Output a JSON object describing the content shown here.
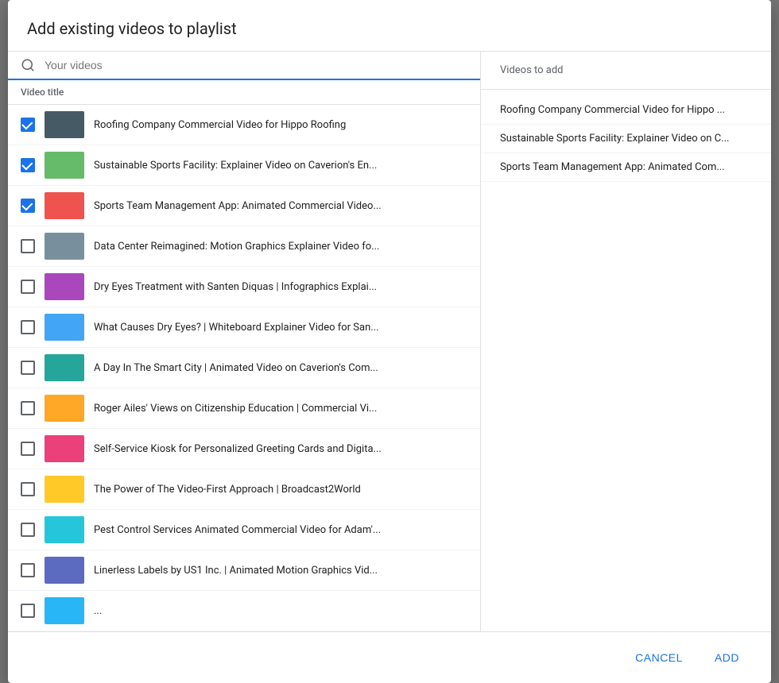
{
  "dialog": {
    "title": "Add existing videos to playlist"
  },
  "search": {
    "placeholder": "Your videos"
  },
  "column_header": "Video title",
  "videos": [
    {
      "id": 1,
      "title": "Roofing Company Commercial Video for Hippo Roofing",
      "checked": true,
      "thumb_class": "thumb-1"
    },
    {
      "id": 2,
      "title": "Sustainable Sports Facility: Explainer Video on Caverion's En...",
      "checked": true,
      "thumb_class": "thumb-2"
    },
    {
      "id": 3,
      "title": "Sports Team Management App: Animated Commercial Video...",
      "checked": true,
      "thumb_class": "thumb-3"
    },
    {
      "id": 4,
      "title": "Data Center Reimagined: Motion Graphics Explainer Video fo...",
      "checked": false,
      "thumb_class": "thumb-4"
    },
    {
      "id": 5,
      "title": "Dry Eyes Treatment with Santen Diquas | Infographics Explai...",
      "checked": false,
      "thumb_class": "thumb-5"
    },
    {
      "id": 6,
      "title": "What Causes Dry Eyes? | Whiteboard Explainer Video for San...",
      "checked": false,
      "thumb_class": "thumb-6"
    },
    {
      "id": 7,
      "title": "A Day In The Smart City | Animated Video on Caverion's Com...",
      "checked": false,
      "thumb_class": "thumb-7"
    },
    {
      "id": 8,
      "title": "Roger Ailes' Views on Citizenship Education | Commercial Vi...",
      "checked": false,
      "thumb_class": "thumb-8"
    },
    {
      "id": 9,
      "title": "Self-Service Kiosk for Personalized Greeting Cards and Digita...",
      "checked": false,
      "thumb_class": "thumb-9"
    },
    {
      "id": 10,
      "title": "The Power of The Video-First Approach | Broadcast2World",
      "checked": false,
      "thumb_class": "thumb-10"
    },
    {
      "id": 11,
      "title": "Pest Control Services Animated Commercial Video for Adam'...",
      "checked": false,
      "thumb_class": "thumb-11"
    },
    {
      "id": 12,
      "title": "Linerless Labels by US1 Inc. | Animated Motion Graphics Vid...",
      "checked": false,
      "thumb_class": "thumb-12"
    },
    {
      "id": 13,
      "title": "...",
      "checked": false,
      "thumb_class": "thumb-13"
    }
  ],
  "right_panel": {
    "header": "Videos to add",
    "items": [
      "Roofing Company Commercial Video for Hippo ...",
      "Sustainable Sports Facility: Explainer Video on C...",
      "Sports Team Management App: Animated Com..."
    ]
  },
  "footer": {
    "cancel_label": "CANCEL",
    "add_label": "ADD"
  }
}
